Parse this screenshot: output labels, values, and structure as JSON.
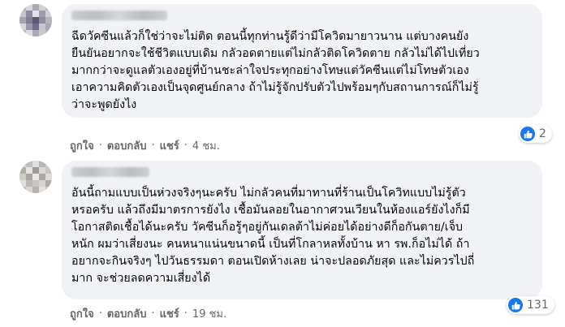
{
  "comments": [
    {
      "text": "ฉีดวัคซีนแล้วก็ใช่ว่าจะไม่ติด ตอนนี้ทุกท่านรู้ดีว่ามีโควิดมายาวนาน แต่บางคนยัง\nยืนยันอยากจะใช้ชีวิตแบบเดิม กลัวอดตายแต่ไม่กลัวติดโควิดตาย กลัวไม่ได้ไปเที่ยว\nมากกว่าจะดูแลตัวเองอยู่ที่บ้านชะล่าใจประทุกอย่างโทษแต่วัคซีนแต่ไม่โทษตัวเอง\nเอาความคิดตัวเองเป็นจุดศูนย์กลาง ถ้าไม่รู้จักปรับตัวไปพร้อมๆกับสถานการณ์ก็ไม่รู้\nว่าจะพูดยังไง",
      "like_label": "ถูกใจ",
      "reply_label": "ตอบกลับ",
      "share_label": "แชร์",
      "time": "4 ชม.",
      "reaction_count": "2"
    },
    {
      "text": "อันนี้ถามแบบเป็นห่วงจริงๆนะครับ ไม่กลัวคนที่มาทานที่ร้านเป็นโควิทแบบไม่รู้ตัว\nหรอครับ แล้วถึงมีมาตรการยังไง เชื้อมันลอยในอากาศวนเวียนในห้องแอร์ยังไงก็มี\nโอกาสติดเชื้อได้นะครับ วัคซีนก็อรู้ๆอยู่กันเดลต้าไม่ค่อยได้อย่างดีก็อกันตาย/เจ็บ\nหนัก ผมว่าเสี่ยงนะ คนหนาแน่นขนาดนี้ เป็นที่โกลาหลทั้งบ้าน หา รพ.ก็อไม่ได้ ถ้า\nอยากจะกินจริงๆ ไปวันธรรมดา ตอนเปิดห้างเลย น่าจะปลอดภัยสุด และไม่ควรไปถี่\nมาก จะช่วยลดความเสี่ยงได้",
      "like_label": "ถูกใจ",
      "reply_label": "ตอบกลับ",
      "share_label": "แชร์",
      "time": "19 ชม.",
      "reaction_count": "131"
    }
  ],
  "separator": "·",
  "colors": {
    "like_blue": "#1877f2",
    "bubble": "#f0f2f5",
    "meta": "#65676b"
  },
  "icons": {
    "reaction": "thumbs-up-icon"
  }
}
